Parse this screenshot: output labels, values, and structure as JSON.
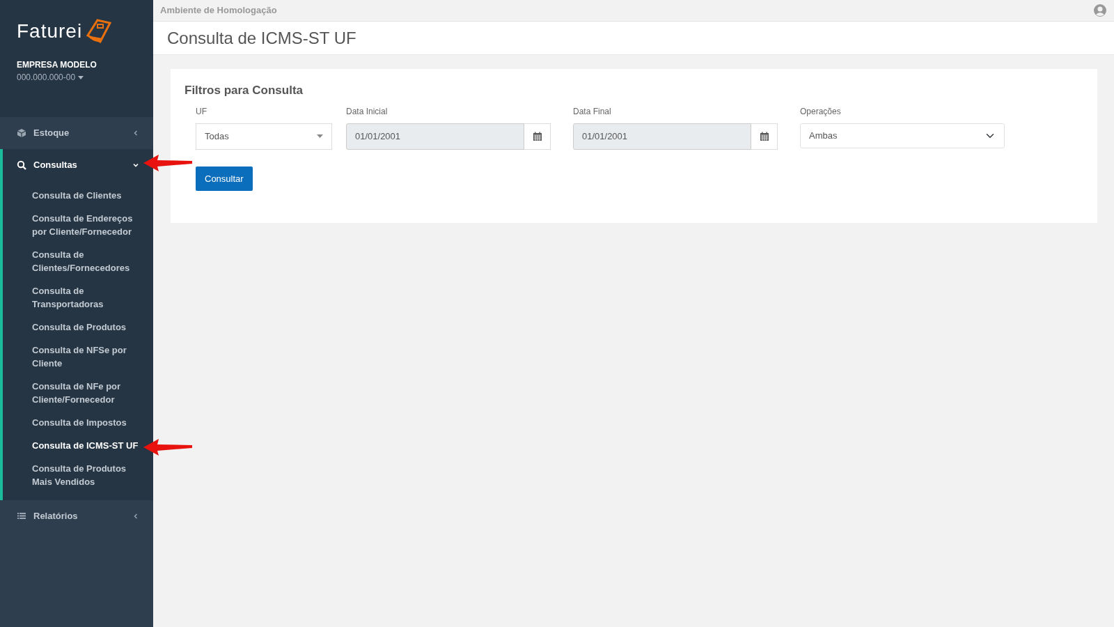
{
  "sidebar": {
    "logo": "Faturei",
    "company": "EMPRESA MODELO",
    "document": "000.000.000-00",
    "items": [
      {
        "label": "Estoque",
        "expanded": false
      },
      {
        "label": "Consultas",
        "expanded": true,
        "children": [
          {
            "label": "Consulta de Clientes",
            "selected": false
          },
          {
            "label": "Consulta de Endereços por Cliente/Fornecedor",
            "selected": false
          },
          {
            "label": "Consulta de Clientes/Fornecedores",
            "selected": false
          },
          {
            "label": "Consulta de Transportadoras",
            "selected": false
          },
          {
            "label": "Consulta de Produtos",
            "selected": false
          },
          {
            "label": "Consulta de NFSe por Cliente",
            "selected": false
          },
          {
            "label": "Consulta de NFe por Cliente/Fornecedor",
            "selected": false
          },
          {
            "label": "Consulta de Impostos",
            "selected": false
          },
          {
            "label": "Consulta de ICMS-ST UF",
            "selected": true
          },
          {
            "label": "Consulta de Produtos Mais Vendidos",
            "selected": false
          }
        ]
      },
      {
        "label": "Relatórios",
        "expanded": false
      }
    ]
  },
  "topbar": {
    "environment": "Ambiente de Homologação"
  },
  "page_title": "Consulta de ICMS-ST UF",
  "filters": {
    "title": "Filtros para Consulta",
    "fields": [
      {
        "kind": "select",
        "label": "UF",
        "value": "Todas"
      },
      {
        "kind": "date",
        "label": "Data Inicial",
        "value": "01/01/2001"
      },
      {
        "kind": "date",
        "label": "Data Final",
        "value": "01/01/2001"
      },
      {
        "kind": "native",
        "label": "Operações",
        "value": "Ambas"
      }
    ],
    "button": "Consultar"
  }
}
